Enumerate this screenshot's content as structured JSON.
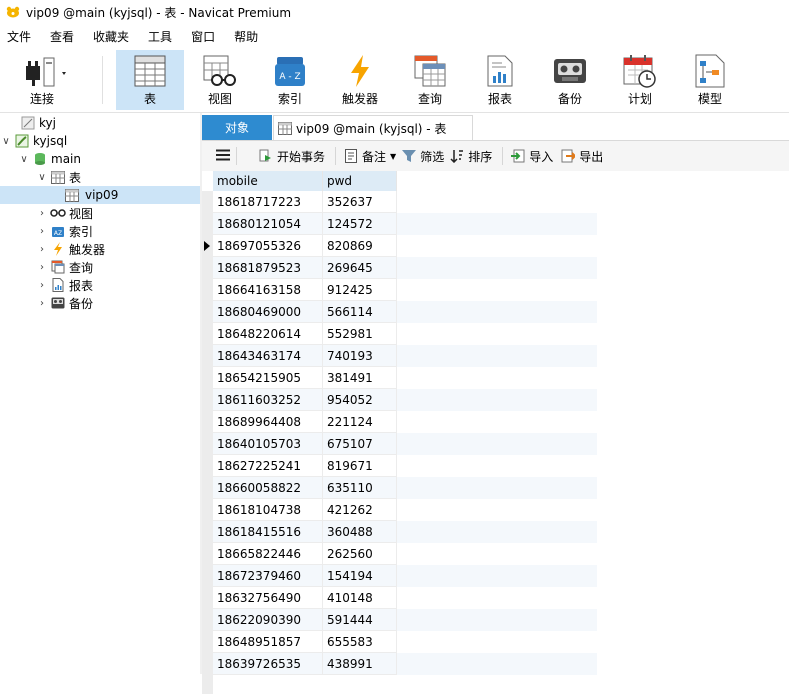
{
  "window": {
    "title": "vip09 @main (kyjsql) - 表 - Navicat Premium"
  },
  "menu": [
    "文件",
    "查看",
    "收藏夹",
    "工具",
    "窗口",
    "帮助"
  ],
  "toolbar": {
    "connect": "连接",
    "table": "表",
    "view": "视图",
    "index": "索引",
    "trigger": "触发器",
    "query": "查询",
    "report": "报表",
    "backup": "备份",
    "schedule": "计划",
    "model": "模型"
  },
  "tree": {
    "kyj": "kyj",
    "kyjsql": "kyjsql",
    "main": "main",
    "tables": "表",
    "vip09": "vip09",
    "views": "视图",
    "indexes": "索引",
    "triggers": "触发器",
    "queries": "查询",
    "reports": "报表",
    "backups": "备份"
  },
  "tabs": {
    "objects": "对象",
    "current": "vip09 @main (kyjsql) - 表"
  },
  "subtoolbar": {
    "begin_tx": "开始事务",
    "note": "备注",
    "filter": "筛选",
    "sort": "排序",
    "import": "导入",
    "export": "导出"
  },
  "grid": {
    "columns": [
      "mobile",
      "pwd"
    ],
    "rows": [
      [
        "18618717223",
        "352637"
      ],
      [
        "18680121054",
        "124572"
      ],
      [
        "18697055326",
        "820869"
      ],
      [
        "18681879523",
        "269645"
      ],
      [
        "18664163158",
        "912425"
      ],
      [
        "18680469000",
        "566114"
      ],
      [
        "18648220614",
        "552981"
      ],
      [
        "18643463174",
        "740193"
      ],
      [
        "18654215905",
        "381491"
      ],
      [
        "18611603252",
        "954052"
      ],
      [
        "18689964408",
        "221124"
      ],
      [
        "18640105703",
        "675107"
      ],
      [
        "18627225241",
        "819671"
      ],
      [
        "18660058822",
        "635110"
      ],
      [
        "18618104738",
        "421262"
      ],
      [
        "18618415516",
        "360488"
      ],
      [
        "18665822446",
        "262560"
      ],
      [
        "18672379460",
        "154194"
      ],
      [
        "18632756490",
        "410148"
      ],
      [
        "18622090390",
        "591444"
      ],
      [
        "18648951857",
        "655583"
      ],
      [
        "18639726535",
        "438991"
      ]
    ],
    "current_row": 2
  }
}
